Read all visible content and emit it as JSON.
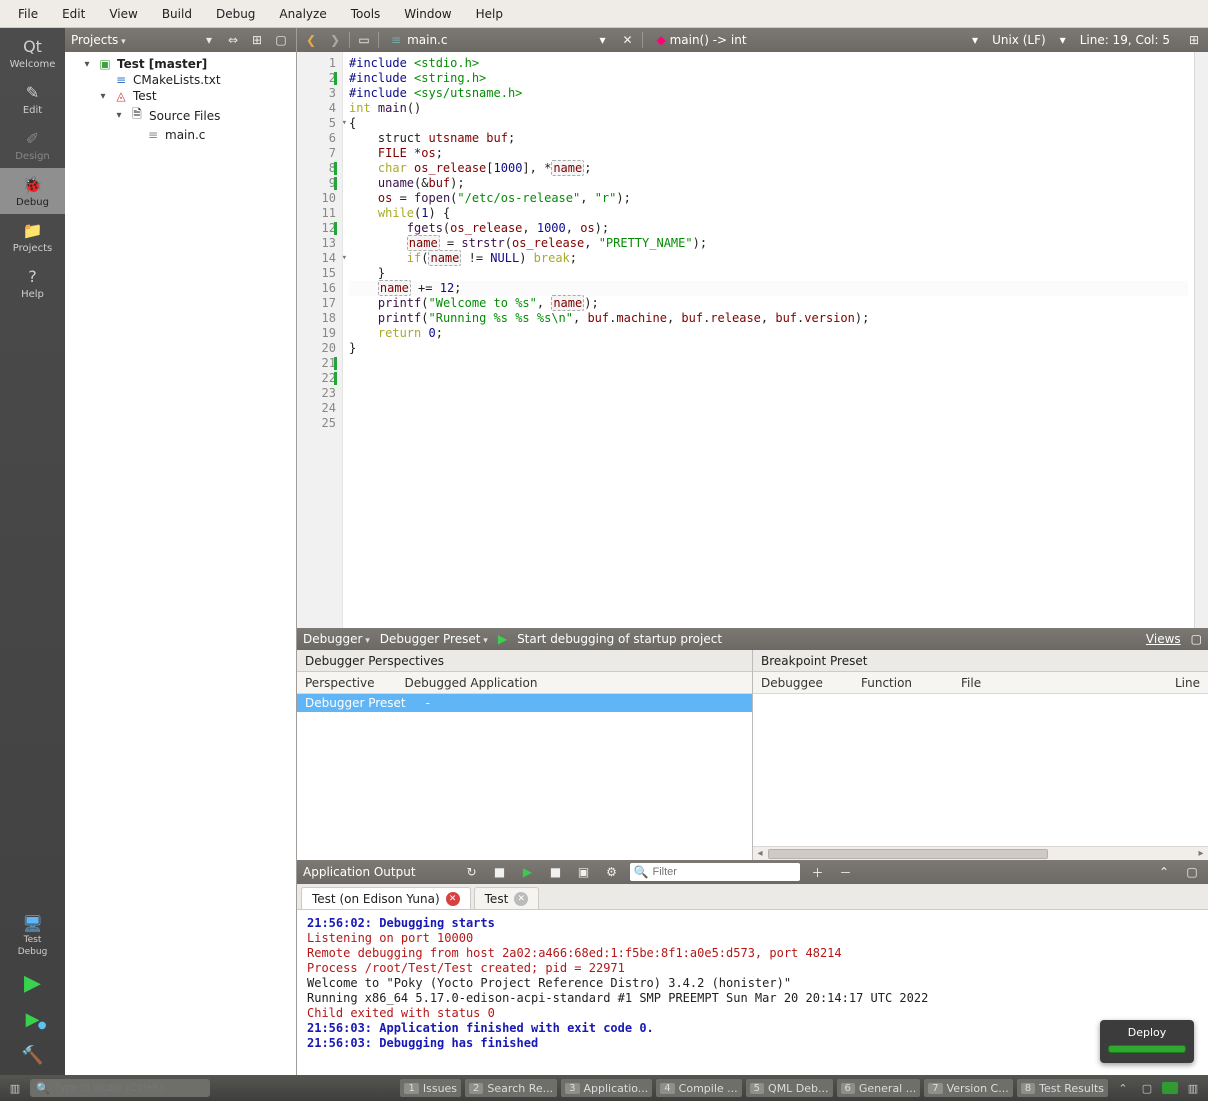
{
  "menu": [
    "File",
    "Edit",
    "View",
    "Build",
    "Debug",
    "Analyze",
    "Tools",
    "Window",
    "Help"
  ],
  "nav": {
    "items": [
      {
        "label": "Welcome",
        "icon": "Qt"
      },
      {
        "label": "Edit",
        "icon": "✎"
      },
      {
        "label": "Design",
        "icon": "✐",
        "disabled": true
      },
      {
        "label": "Debug",
        "icon": "🐞",
        "active": true
      },
      {
        "label": "Projects",
        "icon": "📁"
      },
      {
        "label": "Help",
        "icon": "?"
      }
    ],
    "bottom_kit": "Test",
    "bottom_mode": "Debug"
  },
  "sidebar": {
    "header": "Projects",
    "project": "Test [master]",
    "cmake": "CMakeLists.txt",
    "target": "Test",
    "source_group": "Source Files",
    "file": "main.c"
  },
  "editor": {
    "filename": "main.c",
    "symbol": "main() -> int",
    "encoding": "Unix (LF)",
    "position": "Line: 19, Col: 5",
    "lines": [
      {
        "n": 1,
        "tokens": [
          {
            "t": "#include ",
            "c": "pp"
          },
          {
            "t": "<stdio.h>",
            "c": "ppa"
          }
        ]
      },
      {
        "n": 2,
        "mark": true,
        "tokens": [
          {
            "t": "#include ",
            "c": "pp"
          },
          {
            "t": "<string.h>",
            "c": "ppa"
          }
        ]
      },
      {
        "n": 3,
        "tokens": [
          {
            "t": "#include ",
            "c": "pp"
          },
          {
            "t": "<sys/utsname.h>",
            "c": "ppa"
          }
        ]
      },
      {
        "n": 4,
        "tokens": [
          {
            "t": ""
          }
        ]
      },
      {
        "n": 5,
        "fold": true,
        "tokens": [
          {
            "t": "int ",
            "c": "kw"
          },
          {
            "t": "main",
            "c": "fn"
          },
          {
            "t": "()"
          }
        ]
      },
      {
        "n": 6,
        "tokens": [
          {
            "t": "{"
          }
        ]
      },
      {
        "n": 7,
        "tokens": [
          {
            "t": "    struct "
          },
          {
            "t": "utsname ",
            "c": "ty"
          },
          {
            "t": "buf",
            "c": "id"
          },
          {
            "t": ";"
          }
        ]
      },
      {
        "n": 8,
        "mark": true,
        "tokens": [
          {
            "t": "    "
          },
          {
            "t": "FILE ",
            "c": "ty"
          },
          {
            "t": "*"
          },
          {
            "t": "os",
            "c": "id"
          },
          {
            "t": ";"
          }
        ]
      },
      {
        "n": 9,
        "mark": true,
        "tokens": [
          {
            "t": "    "
          },
          {
            "t": "char ",
            "c": "kw"
          },
          {
            "t": "os_release",
            "c": "id"
          },
          {
            "t": "["
          },
          {
            "t": "1000",
            "c": "num"
          },
          {
            "t": "], *"
          },
          {
            "t": "name",
            "c": "id box"
          },
          {
            "t": ";"
          }
        ]
      },
      {
        "n": 10,
        "tokens": [
          {
            "t": ""
          }
        ]
      },
      {
        "n": 11,
        "tokens": [
          {
            "t": "    "
          },
          {
            "t": "uname",
            "c": "fn"
          },
          {
            "t": "(&"
          },
          {
            "t": "buf",
            "c": "id"
          },
          {
            "t": ");"
          }
        ]
      },
      {
        "n": 12,
        "mark": true,
        "tokens": [
          {
            "t": ""
          }
        ]
      },
      {
        "n": 13,
        "tokens": [
          {
            "t": "    "
          },
          {
            "t": "os",
            "c": "id"
          },
          {
            "t": " = "
          },
          {
            "t": "fopen",
            "c": "fn"
          },
          {
            "t": "("
          },
          {
            "t": "\"/etc/os-release\"",
            "c": "str"
          },
          {
            "t": ", "
          },
          {
            "t": "\"r\"",
            "c": "str"
          },
          {
            "t": ");"
          }
        ]
      },
      {
        "n": 14,
        "fold": true,
        "tokens": [
          {
            "t": "    "
          },
          {
            "t": "while",
            "c": "kw"
          },
          {
            "t": "("
          },
          {
            "t": "1",
            "c": "num"
          },
          {
            "t": ") {"
          }
        ]
      },
      {
        "n": 15,
        "tokens": [
          {
            "t": "        "
          },
          {
            "t": "fgets",
            "c": "fn"
          },
          {
            "t": "("
          },
          {
            "t": "os_release",
            "c": "id"
          },
          {
            "t": ", "
          },
          {
            "t": "1000",
            "c": "num"
          },
          {
            "t": ", "
          },
          {
            "t": "os",
            "c": "id"
          },
          {
            "t": ");"
          }
        ]
      },
      {
        "n": 16,
        "tokens": [
          {
            "t": "        "
          },
          {
            "t": "name",
            "c": "id box"
          },
          {
            "t": " = "
          },
          {
            "t": "strstr",
            "c": "fn"
          },
          {
            "t": "("
          },
          {
            "t": "os_release",
            "c": "id"
          },
          {
            "t": ", "
          },
          {
            "t": "\"PRETTY_NAME\"",
            "c": "str"
          },
          {
            "t": ");"
          }
        ]
      },
      {
        "n": 17,
        "tokens": [
          {
            "t": "        "
          },
          {
            "t": "if",
            "c": "kw"
          },
          {
            "t": "("
          },
          {
            "t": "name",
            "c": "id box"
          },
          {
            "t": " != "
          },
          {
            "t": "NULL",
            "c": "pp"
          },
          {
            "t": ") "
          },
          {
            "t": "break",
            "c": "kw"
          },
          {
            "t": ";"
          }
        ]
      },
      {
        "n": 18,
        "tokens": [
          {
            "t": "    }"
          }
        ]
      },
      {
        "n": 19,
        "current": true,
        "tokens": [
          {
            "t": "    "
          },
          {
            "t": "name",
            "c": "id box"
          },
          {
            "t": " += "
          },
          {
            "t": "12",
            "c": "num"
          },
          {
            "t": ";"
          }
        ]
      },
      {
        "n": 20,
        "tokens": [
          {
            "t": ""
          }
        ]
      },
      {
        "n": 21,
        "mark": true,
        "tokens": [
          {
            "t": "    "
          },
          {
            "t": "printf",
            "c": "fn"
          },
          {
            "t": "("
          },
          {
            "t": "\"Welcome to %s\"",
            "c": "str"
          },
          {
            "t": ", "
          },
          {
            "t": "name",
            "c": "id box"
          },
          {
            "t": ");"
          }
        ]
      },
      {
        "n": 22,
        "mark": true,
        "tokens": [
          {
            "t": "    "
          },
          {
            "t": "printf",
            "c": "fn"
          },
          {
            "t": "("
          },
          {
            "t": "\"Running %s %s %s\\n\"",
            "c": "str"
          },
          {
            "t": ", "
          },
          {
            "t": "buf",
            "c": "id"
          },
          {
            "t": "."
          },
          {
            "t": "machine",
            "c": "id"
          },
          {
            "t": ", "
          },
          {
            "t": "buf",
            "c": "id"
          },
          {
            "t": "."
          },
          {
            "t": "release",
            "c": "id"
          },
          {
            "t": ", "
          },
          {
            "t": "buf",
            "c": "id"
          },
          {
            "t": "."
          },
          {
            "t": "version",
            "c": "id"
          },
          {
            "t": ");"
          }
        ]
      },
      {
        "n": 23,
        "tokens": [
          {
            "t": "    "
          },
          {
            "t": "return ",
            "c": "kw"
          },
          {
            "t": "0",
            "c": "num"
          },
          {
            "t": ";"
          }
        ]
      },
      {
        "n": 24,
        "tokens": [
          {
            "t": "}"
          }
        ]
      },
      {
        "n": 25,
        "tokens": [
          {
            "t": ""
          }
        ]
      }
    ]
  },
  "dbgstrip": {
    "label": "Debugger",
    "preset": "Debugger Preset",
    "action": "Start debugging of startup project",
    "views": "Views"
  },
  "dbgleft": {
    "title": "Debugger Perspectives",
    "cols": [
      "Perspective",
      "Debugged Application"
    ],
    "row": [
      "Debugger Preset",
      "-"
    ]
  },
  "dbgright": {
    "title": "Breakpoint Preset",
    "cols": [
      "Debuggee",
      "Function",
      "File",
      "Line"
    ]
  },
  "output": {
    "title": "Application Output",
    "filter_ph": "Filter",
    "tabs": [
      {
        "label": "Test (on Edison Yuna)",
        "close": "red",
        "active": true
      },
      {
        "label": "Test",
        "close": "gray"
      }
    ],
    "lines": [
      {
        "t": "21:56:02: Debugging starts",
        "c": "c-blue"
      },
      {
        "t": "Listening on port 10000",
        "c": "c-red"
      },
      {
        "t": "Remote debugging from host 2a02:a466:68ed:1:f5be:8f1:a0e5:d573, port 48214",
        "c": "c-red"
      },
      {
        "t": "Process /root/Test/Test created; pid = 22971",
        "c": "c-red"
      },
      {
        "t": "Welcome to \"Poky (Yocto Project Reference Distro) 3.4.2 (honister)\""
      },
      {
        "t": "Running x86_64 5.17.0-edison-acpi-standard #1 SMP PREEMPT Sun Mar 20 20:14:17 UTC 2022"
      },
      {
        "t": ""
      },
      {
        "t": "Child exited with status 0",
        "c": "c-red"
      },
      {
        "t": "21:56:03: Application finished with exit code 0.",
        "c": "c-blue"
      },
      {
        "t": "21:56:03: Debugging has finished",
        "c": "c-blue"
      }
    ]
  },
  "toast": {
    "title": "Deploy"
  },
  "status": {
    "locate_ph": "Type to locate (Ctrl+K)",
    "pills": [
      {
        "n": "1",
        "label": "Issues"
      },
      {
        "n": "2",
        "label": "Search Re..."
      },
      {
        "n": "3",
        "label": "Applicatio..."
      },
      {
        "n": "4",
        "label": "Compile ..."
      },
      {
        "n": "5",
        "label": "QML Deb..."
      },
      {
        "n": "6",
        "label": "General ..."
      },
      {
        "n": "7",
        "label": "Version C..."
      },
      {
        "n": "8",
        "label": "Test Results"
      }
    ]
  }
}
